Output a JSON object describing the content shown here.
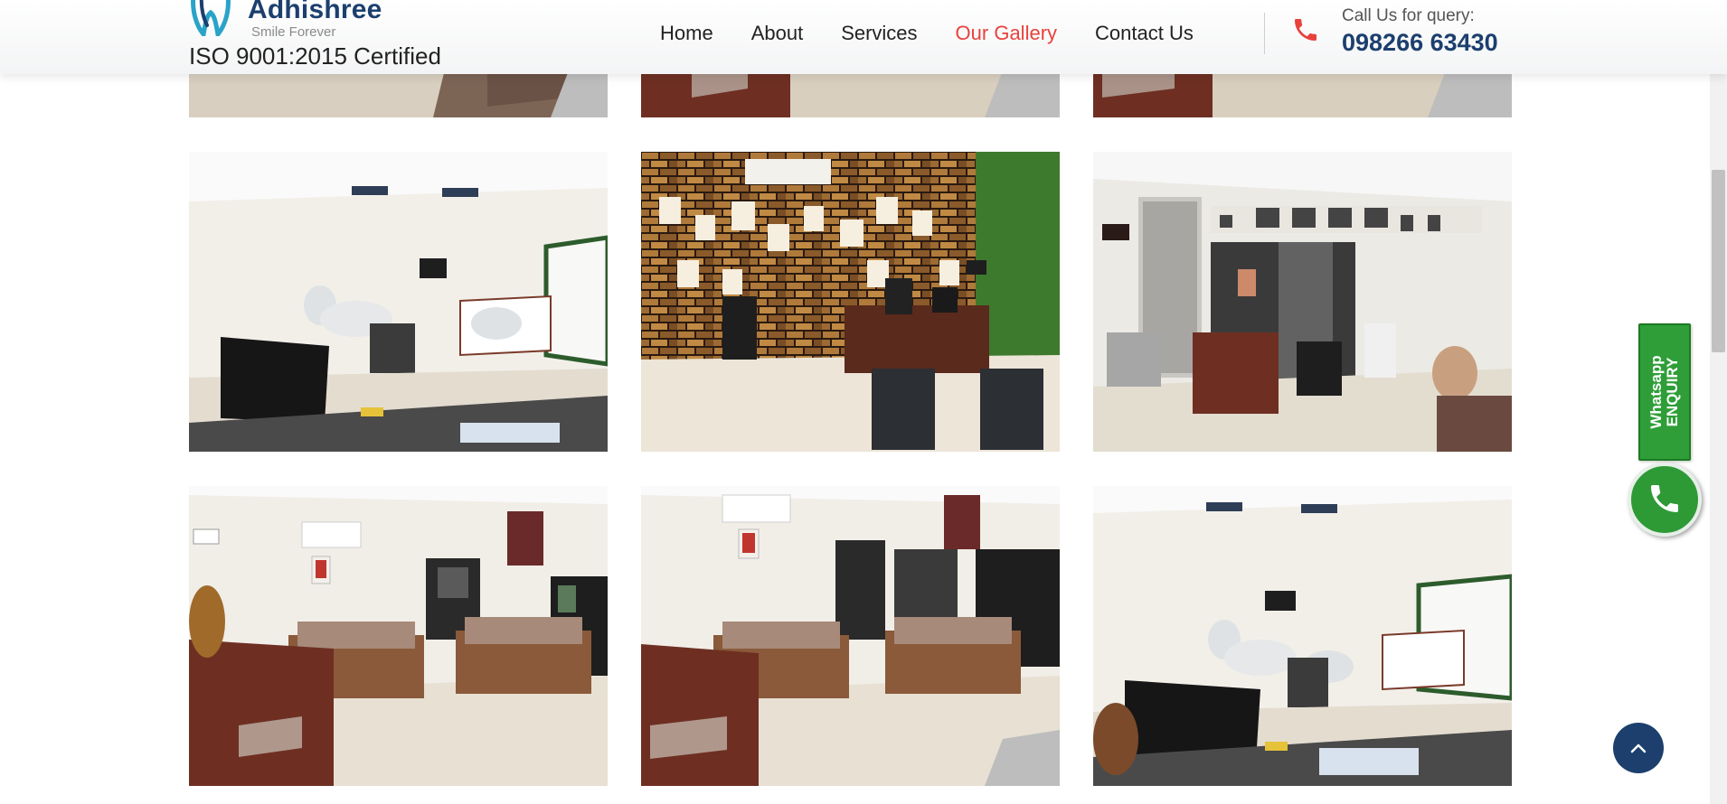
{
  "header": {
    "brand_name": "Adhishree",
    "brand_tagline": "Smile Forever",
    "certification": "ISO 9001:2015 Certified",
    "logo_icon": "tooth-logo-icon",
    "nav": [
      {
        "label": "Home",
        "active": false
      },
      {
        "label": "About",
        "active": false
      },
      {
        "label": "Services",
        "active": false
      },
      {
        "label": "Our Gallery",
        "active": true
      },
      {
        "label": "Contact Us",
        "active": false
      }
    ],
    "call_label": "Call Us for query:",
    "call_number": "098266 63430",
    "phone_icon": "phone-icon"
  },
  "gallery": {
    "images": [
      {
        "scene": "reception"
      },
      {
        "scene": "reception"
      },
      {
        "scene": "reception"
      },
      {
        "scene": "dental-operatory"
      },
      {
        "scene": "doctor-cabin"
      },
      {
        "scene": "waiting-area"
      },
      {
        "scene": "reception-sofas"
      },
      {
        "scene": "reception-sofas"
      },
      {
        "scene": "dental-operatory"
      }
    ]
  },
  "whatsapp": {
    "line1": "Whatsapp",
    "line2": "ENQUIRY",
    "icon": "whatsapp-phone-icon"
  },
  "back_to_top": {
    "icon": "chevron-up-icon"
  },
  "colors": {
    "brand_navy": "#1c3f6e",
    "active_nav": "#e8423c",
    "whatsapp_green": "#2f9e38"
  }
}
